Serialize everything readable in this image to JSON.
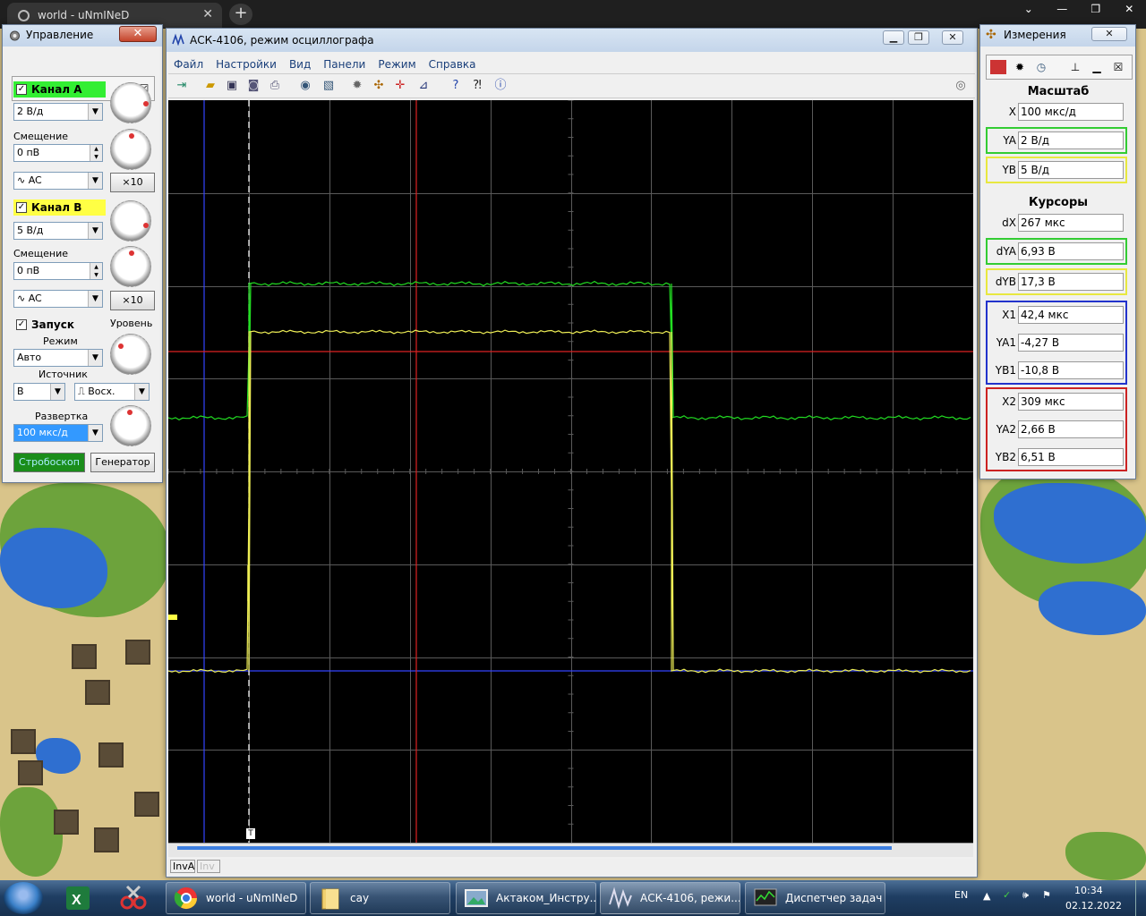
{
  "browser": {
    "tab_title": "world - uNmINeD",
    "new_tab": "+",
    "close": "✕",
    "controls": [
      "⌄",
      "—",
      "❐",
      "✕"
    ]
  },
  "control_panel": {
    "title": "Управление",
    "close": "✕",
    "channel_a": {
      "label": "Канал A",
      "color": "#33ee33",
      "checked": "✓",
      "volts_per_div": "2 В/д",
      "offset_label": "Смещение",
      "offset_value": "0 пВ",
      "coupling": "AC",
      "x10": "×10"
    },
    "channel_b": {
      "label": "Канал B",
      "color": "#ffff44",
      "checked": "✓",
      "volts_per_div": "5 В/д",
      "offset_label": "Смещение",
      "offset_value": "0 пВ",
      "coupling": "AC",
      "x10": "×10"
    },
    "trigger": {
      "label": "Запуск",
      "checked": "✓",
      "level_label": "Уровень",
      "mode_label": "Режим",
      "mode_value": "Авто",
      "source_label": "Источник",
      "source_value": "B",
      "edge_value": "Восх."
    },
    "sweep": {
      "label": "Развертка",
      "value": "100 мкс/д"
    },
    "buttons": {
      "strobe": "Стробоскоп",
      "generator": "Генератор"
    }
  },
  "oscilloscope": {
    "title": "АСК-4106, режим осциллографа",
    "menu": [
      "Файл",
      "Настройки",
      "Вид",
      "Панели",
      "Режим",
      "Справка"
    ],
    "trigger_marker": "T",
    "status": [
      "InvA",
      "Inv"
    ],
    "colors": {
      "channel_a": "#22dd22",
      "channel_b": "#eeee55",
      "cursor1": "#3344ff",
      "cursor2": "#dd2222",
      "grid": "#5a5a5a"
    }
  },
  "measurements": {
    "title": "Измерения",
    "scale_heading": "Масштаб",
    "scale": [
      {
        "label": "X",
        "value": "100 мкс/д"
      },
      {
        "label": "YA",
        "value": "2 В/д"
      },
      {
        "label": "YB",
        "value": "5 В/д"
      }
    ],
    "cursors_heading": "Курсоры",
    "delta": [
      {
        "label": "dX",
        "value": "267 мкс"
      },
      {
        "label": "dYA",
        "value": "6,93 В"
      },
      {
        "label": "dYB",
        "value": "17,3 В"
      }
    ],
    "cursor1": [
      {
        "label": "X1",
        "value": "42,4 мкс"
      },
      {
        "label": "YA1",
        "value": "-4,27 В"
      },
      {
        "label": "YB1",
        "value": "-10,8 В"
      }
    ],
    "cursor2": [
      {
        "label": "X2",
        "value": "309 мкс"
      },
      {
        "label": "YA2",
        "value": "2,66 В"
      },
      {
        "label": "YB2",
        "value": "6,51 В"
      }
    ]
  },
  "taskbar": {
    "items": [
      {
        "label": "world - uNmINeD"
      },
      {
        "label": "cay"
      },
      {
        "label": "Актаком_Инстру..."
      },
      {
        "label": "АСК-4106, режи..."
      },
      {
        "label": "Диспетчер задач ..."
      }
    ],
    "lang": "EN",
    "time": "10:34",
    "date": "02.12.2022"
  }
}
